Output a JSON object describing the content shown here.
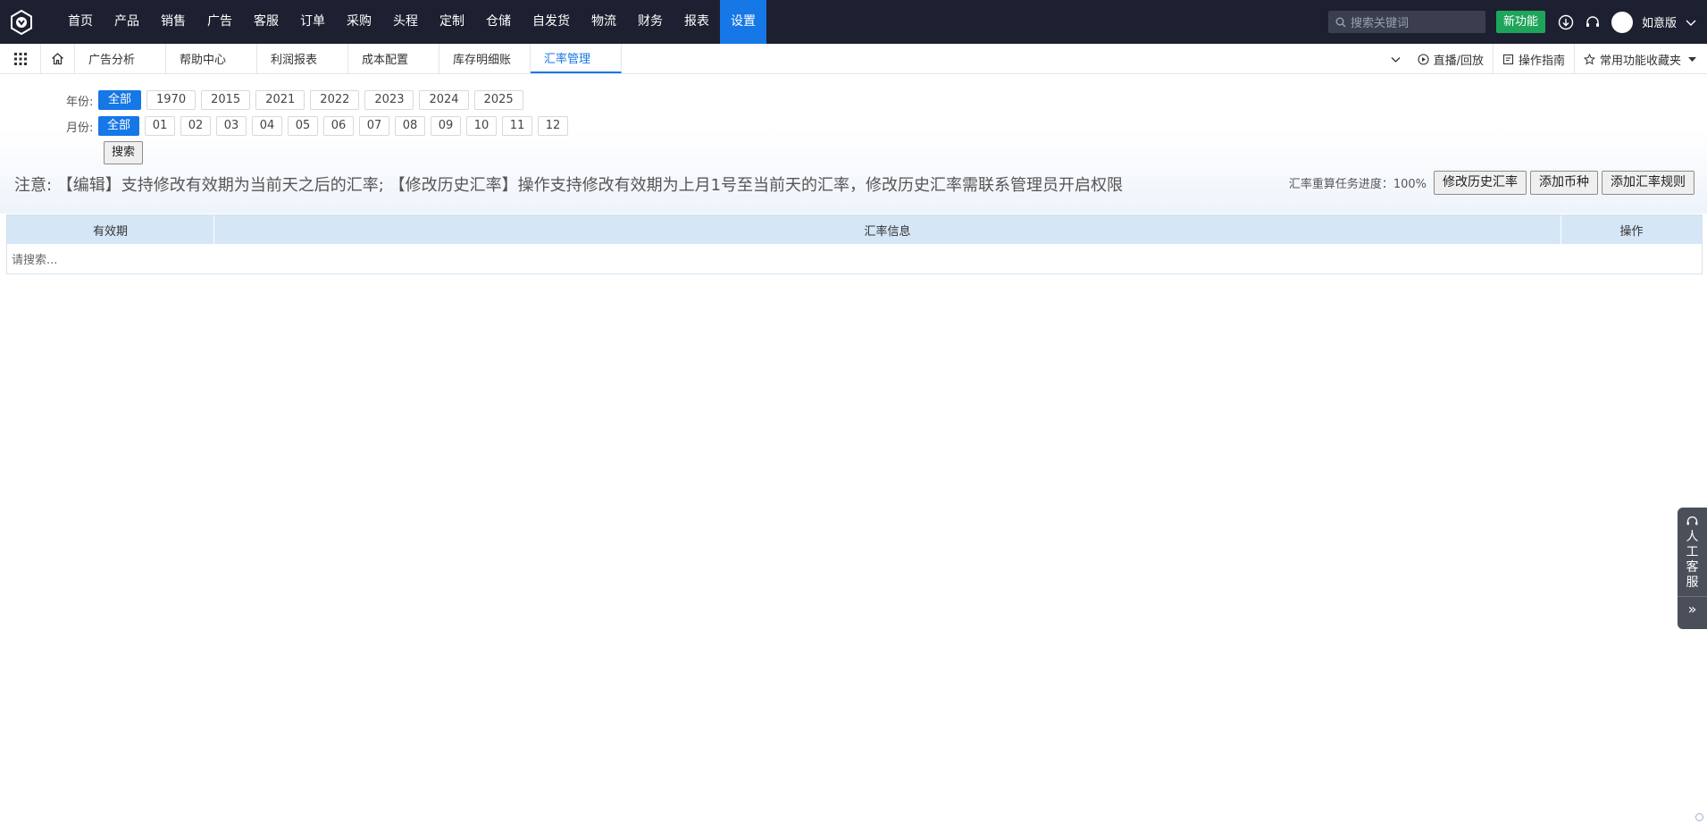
{
  "topnav": {
    "items": [
      "首页",
      "产品",
      "销售",
      "广告",
      "客服",
      "订单",
      "采购",
      "头程",
      "定制",
      "仓储",
      "自发货",
      "物流",
      "财务",
      "报表",
      "设置"
    ],
    "active_index": 14,
    "search_placeholder": "搜索关键词",
    "new_feature_label": "新功能",
    "user_name": "如意版"
  },
  "tabbar": {
    "tabs": [
      "广告分析",
      "帮助中心",
      "利润报表",
      "成本配置",
      "库存明细账",
      "汇率管理"
    ],
    "active_index": 5,
    "live_label": "直播/回放",
    "guide_label": "操作指南",
    "favorites_label": "常用功能收藏夹"
  },
  "filters": {
    "year_label": "年份:",
    "years": [
      "全部",
      "1970",
      "2015",
      "2021",
      "2022",
      "2023",
      "2024",
      "2025"
    ],
    "month_label": "月份:",
    "months": [
      "全部",
      "01",
      "02",
      "03",
      "04",
      "05",
      "06",
      "07",
      "08",
      "09",
      "10",
      "11",
      "12"
    ],
    "search_button": "搜索"
  },
  "notice": "注意: 【编辑】支持修改有效期为当前天之后的汇率; 【修改历史汇率】操作支持修改有效期为上月1号至当前天的汇率，修改历史汇率需联系管理员开启权限",
  "actions": {
    "progress_text": "汇率重算任务进度：100%",
    "edit_history_button": "修改历史汇率",
    "add_currency_button": "添加币种",
    "add_rule_button": "添加汇率规则"
  },
  "table": {
    "columns": [
      "有效期",
      "汇率信息",
      "操作"
    ],
    "empty_text": "请搜索..."
  },
  "float_panel": {
    "label": "人工客服",
    "expand": "»"
  },
  "colors": {
    "topbar_bg": "#1d2030",
    "accent": "#1677e6",
    "new_feature": "#1fa55b",
    "table_header": "#d5e6f6"
  }
}
